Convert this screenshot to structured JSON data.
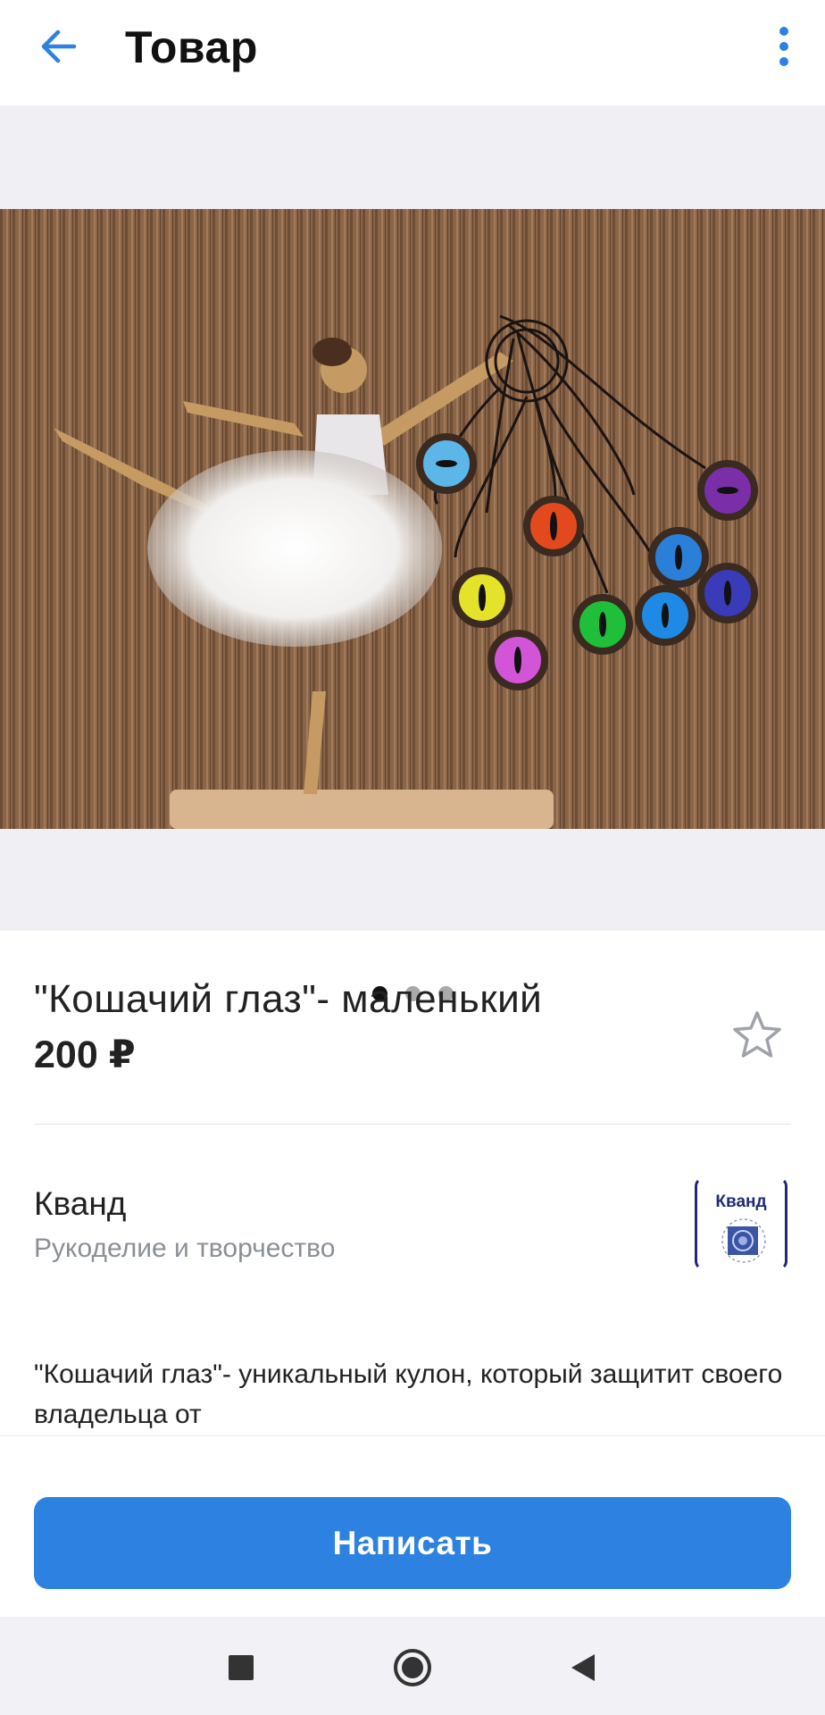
{
  "header": {
    "title": "Товар",
    "back_icon": "arrow-left-icon",
    "more_icon": "more-vertical-icon",
    "accent_color": "#2d81e0"
  },
  "gallery": {
    "image_count": 3,
    "active_index": 0,
    "image_subject": "ballerina figure with cat-eye pendants"
  },
  "product": {
    "name": "\"Кошачий глаз\"- маленький",
    "price": "200 ₽",
    "favorite_icon": "star-outline-icon"
  },
  "shop": {
    "name": "Кванд",
    "category": "Рукоделие и творчество",
    "logo_text": "Кванд"
  },
  "description": {
    "text": "\"Кошачий глаз\"- уникальный кулон, который защитит своего владельца от"
  },
  "actions": {
    "write_label": "Написать",
    "button_color": "#2d81e0"
  },
  "system_nav": {
    "recent_icon": "square-icon",
    "home_icon": "circle-home-icon",
    "back_icon": "triangle-back-icon"
  }
}
